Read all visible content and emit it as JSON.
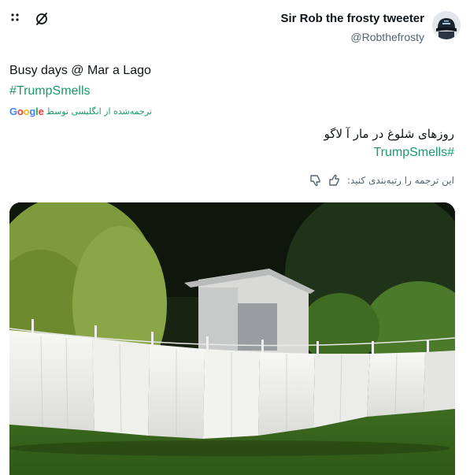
{
  "toolbar": {
    "more_icon": "more-dots-icon",
    "no_translate_icon": "slashed-circle-icon"
  },
  "author": {
    "name": "Sir Rob the frosty tweeter",
    "handle": "@Robthefrosty",
    "avatar_icon": "avatar-cap-icon"
  },
  "tweet": {
    "original_text": "Busy days @ Mar a Lago",
    "original_hashtag": "#TrumpSmells",
    "translated_by_label": "ترجمه‌شده از انگلیسی توسط",
    "translator_brand": "Google",
    "translated_text": "روزهای شلوغ در مار آ لاگو",
    "translated_hashtag": "#TrumpSmells"
  },
  "rating": {
    "label": "این ترجمه را رتبه‌بندی کنید:",
    "thumbs_up_icon": "thumbs-up-icon",
    "thumbs_down_icon": "thumbs-down-icon"
  },
  "media": {
    "image_subject": "white sheets hanging on a clothesline in front of a shed and trees"
  },
  "colors": {
    "hashtag": "#1a9a6b",
    "secondary_text": "#536471",
    "primary_text": "#0f1419"
  }
}
